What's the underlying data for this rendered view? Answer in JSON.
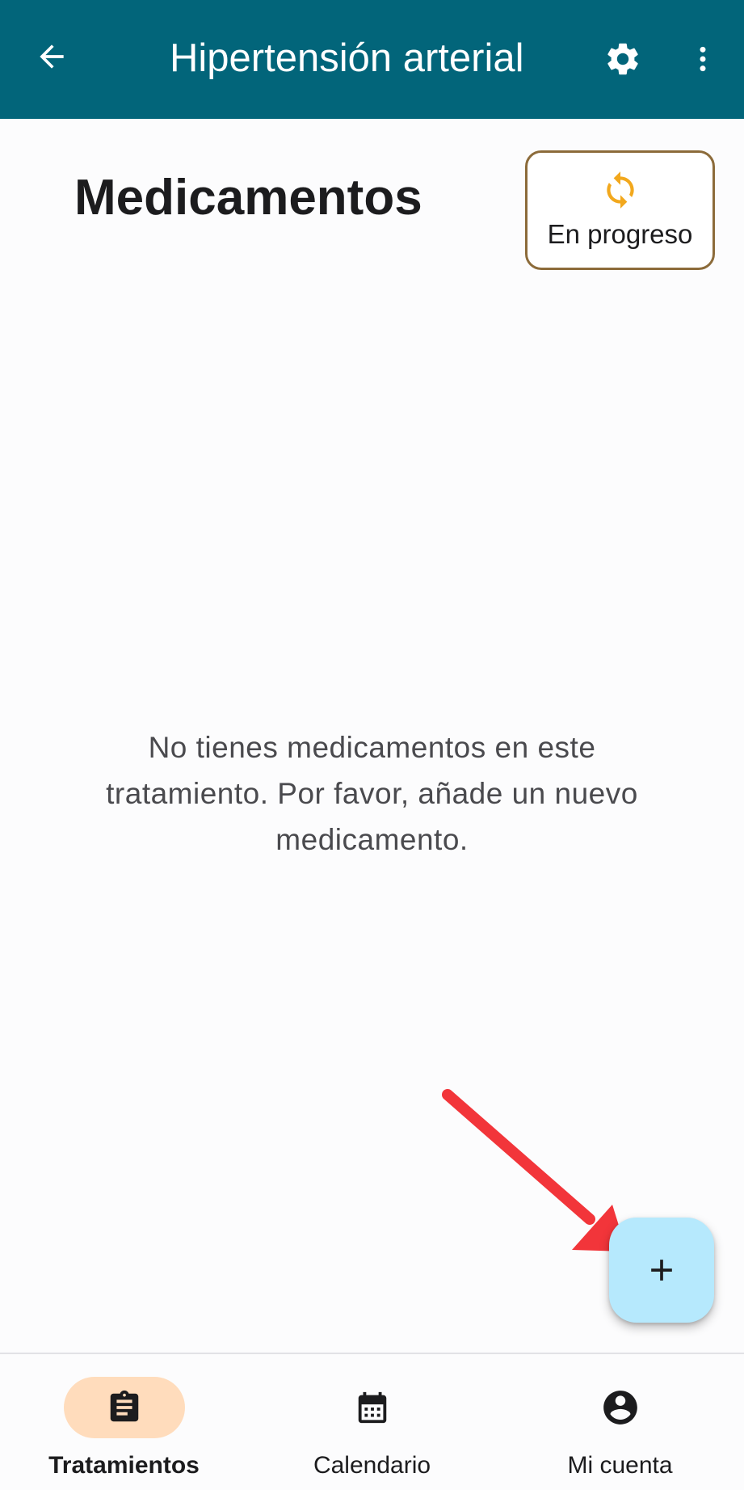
{
  "app_bar": {
    "title": "Hipertensión arterial",
    "back_icon": "arrow-back-icon",
    "settings_icon": "gear-icon",
    "more_icon": "more-vert-icon",
    "background": "#02657a"
  },
  "header": {
    "title": "Medicamentos",
    "status": {
      "label": "En progreso",
      "icon": "sync-icon",
      "icon_color": "#f2a81d",
      "border_color": "#8c6b3a"
    }
  },
  "empty_state": {
    "message": "No tienes medicamentos en este tratamiento. Por favor, añade un nuevo medicamento."
  },
  "fab": {
    "icon": "plus-icon",
    "background": "#b6e9fd"
  },
  "annotation": {
    "icon": "red-arrow-icon",
    "color": "#f2353a"
  },
  "bottom_nav": {
    "items": [
      {
        "label": "Tratamientos",
        "icon": "clipboard-icon",
        "active": true
      },
      {
        "label": "Calendario",
        "icon": "calendar-icon",
        "active": false
      },
      {
        "label": "Mi cuenta",
        "icon": "account-circle-icon",
        "active": false
      }
    ],
    "active_color": "#ffdcbc"
  }
}
